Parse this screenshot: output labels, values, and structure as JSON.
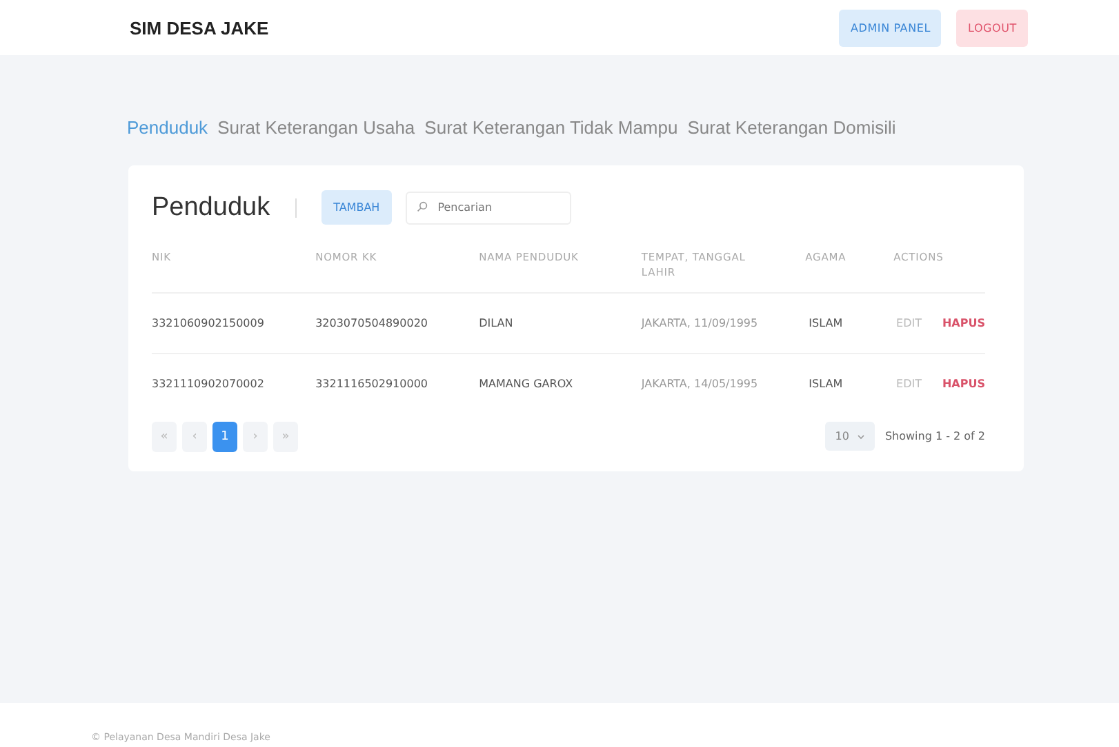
{
  "header": {
    "brand": "SIM DESA JAKE",
    "buttons": [
      {
        "label": "ADMIN PANEL",
        "kind": "primary"
      },
      {
        "label": "LOGOUT",
        "kind": "danger"
      }
    ]
  },
  "tabs": [
    {
      "label": "Penduduk",
      "selected": true
    },
    {
      "label": "Surat Keterangan Usaha",
      "selected": false
    },
    {
      "label": "Surat Keterangan Tidak Mampu",
      "selected": false
    },
    {
      "label": "Surat Keterangan Domisili",
      "selected": false
    }
  ],
  "card": {
    "title": "Penduduk",
    "add_button": "TAMBAH",
    "search": {
      "placeholder": "Pencarian"
    }
  },
  "table": {
    "columns": [
      "NIK",
      "NOMOR KK",
      "NAMA PENDUDUK",
      "TEMPAT, TANGGAL LAHIR",
      "AGAMA",
      "ACTIONS"
    ],
    "rows": [
      {
        "cells": [
          "3321060902150009",
          "3203070504890020",
          "DILAN",
          "JAKARTA, 11/09/1995",
          "ISLAM"
        ],
        "actions": [
          "EDIT",
          "HAPUS"
        ]
      },
      {
        "cells": [
          "3321110902070002",
          "3321116502910000",
          "MAMANG GAROX",
          "JAKARTA, 14/05/1995",
          "ISLAM"
        ],
        "actions": [
          "EDIT",
          "HAPUS"
        ]
      }
    ]
  },
  "pagination": {
    "pages": [
      {
        "label": "«",
        "selected": false
      },
      {
        "label": "‹",
        "selected": false
      },
      {
        "label": "1",
        "selected": true
      },
      {
        "label": "›",
        "selected": false
      },
      {
        "label": "»",
        "selected": false
      }
    ],
    "per_page": "10",
    "summary": "Showing 1 - 2 of 2"
  },
  "footer": "© Pelayanan Desa Mandiri Desa Jake"
}
